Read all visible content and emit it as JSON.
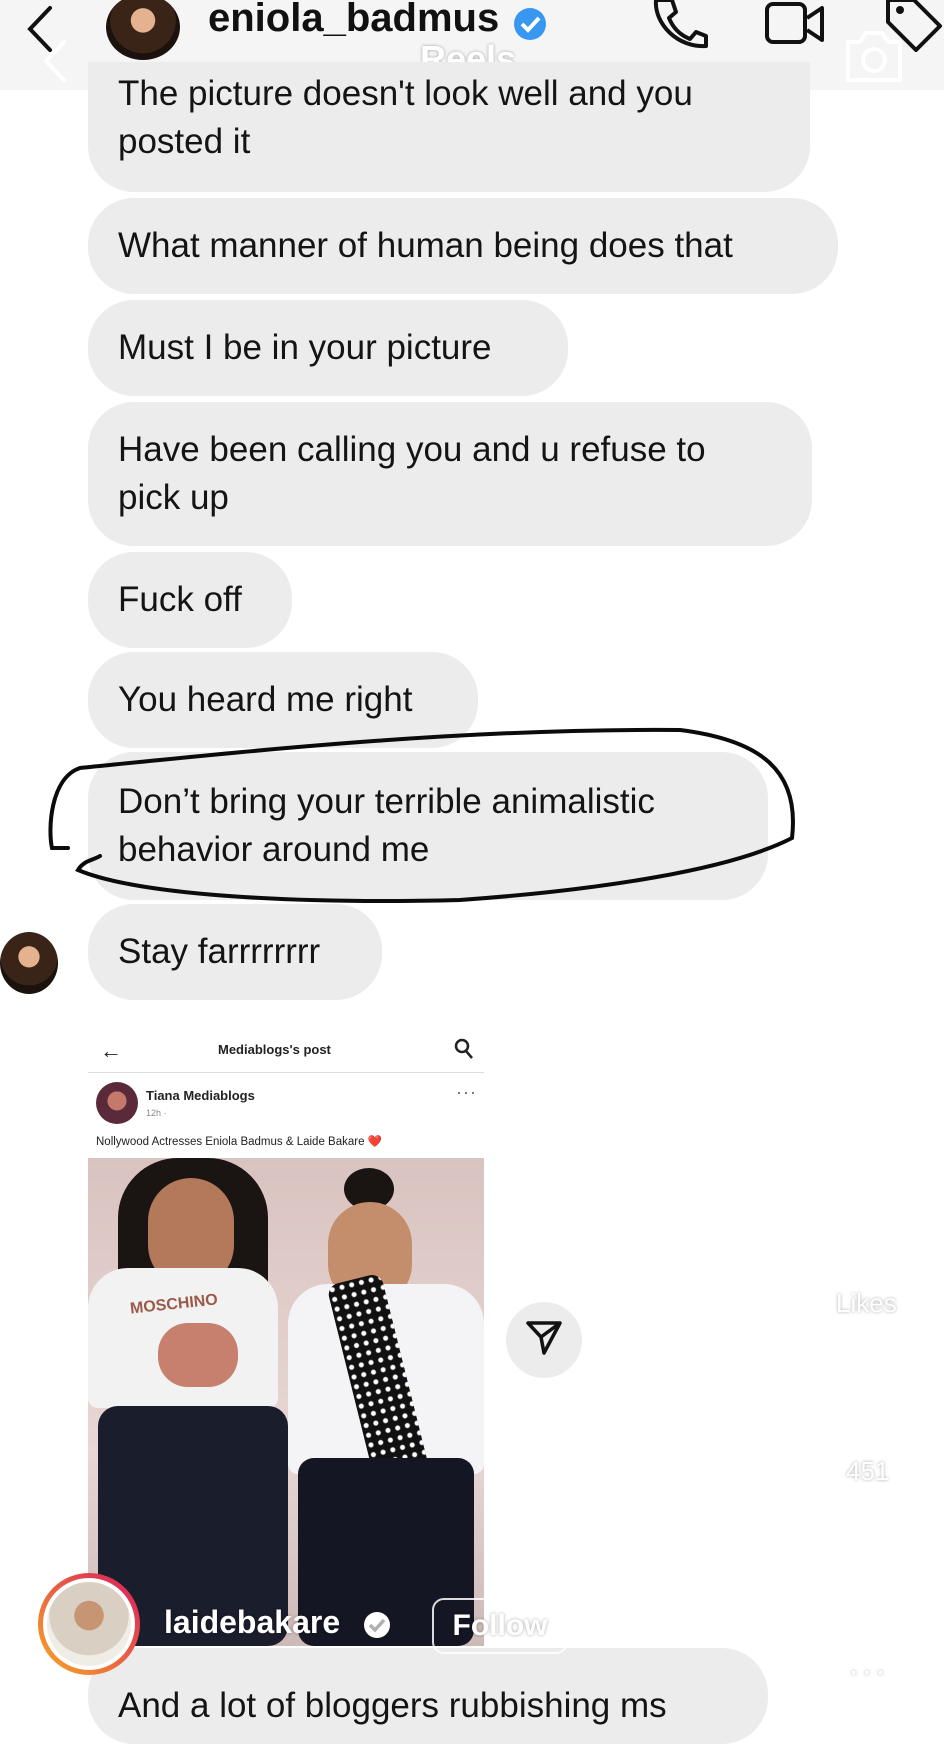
{
  "reels_overlay": {
    "title": "Reels",
    "likes_label": "Likes",
    "comments_count": "451",
    "author_handle": "laidebakare",
    "follow_label": "Follow"
  },
  "chat_header": {
    "username": "eniola_badmus"
  },
  "messages": [
    "The picture doesn't look well and you posted it",
    "What manner of human being does that",
    "Must I be in your picture",
    "Have been calling you and u refuse to pick up",
    "Fuck off",
    "You heard me right",
    "Don’t bring your terrible animalistic behavior around me",
    "Stay farrrrrrrr",
    "And a lot of bloggers rubbishing ms"
  ],
  "shared_post": {
    "header_title": "Mediablogs's post",
    "author": "Tiana Mediablogs",
    "meta": "12h · ",
    "caption": "Nollywood Actresses Eniola Badmus & Laide Bakare ❤️",
    "shirt_text": "MOSCHINO"
  },
  "colors": {
    "bubble": "#ececec",
    "verified": "#3897f0",
    "story_ring_start": "#f9a825",
    "story_ring_end": "#d81b60"
  },
  "icons": [
    "back-chevron-icon",
    "verified-icon",
    "phone-icon",
    "video-icon",
    "tag-icon",
    "camera-icon",
    "back-arrow-icon",
    "search-icon",
    "more-icon",
    "send-icon",
    "heart-icon",
    "comment-icon",
    "share-icon",
    "more-dots-icon"
  ]
}
